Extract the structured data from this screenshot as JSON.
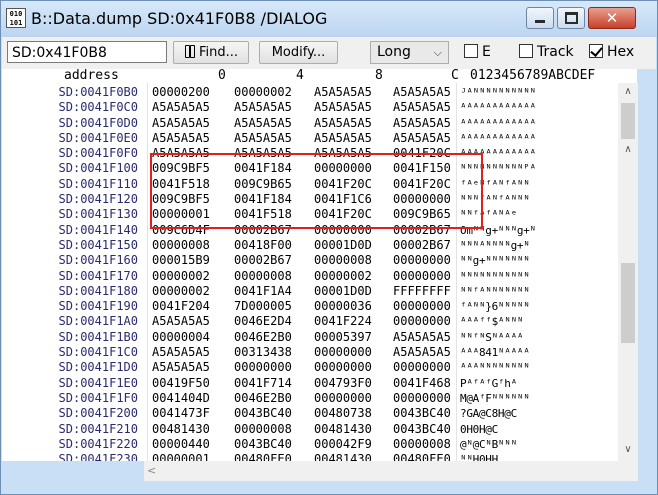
{
  "window": {
    "title": "B::Data.dump SD:0x41F0B8 /DIALOG",
    "icon_text": "010 101"
  },
  "toolbar": {
    "address_value": "SD:0x41F0B8",
    "find_label": "Find...",
    "modify_label": "Modify...",
    "format_selected": "Long",
    "checkbox_e_label": "E",
    "checkbox_e_checked": false,
    "checkbox_track_label": "Track",
    "checkbox_track_checked": false,
    "checkbox_hex_label": "Hex",
    "checkbox_hex_checked": true
  },
  "header": {
    "address": "address",
    "col0": "0",
    "col4": "4",
    "col8": "8",
    "colC": "C",
    "ascii": "0123456789ABCDEF"
  },
  "rows": [
    {
      "addr": "SD:0041F0B0",
      "c0": "00000200",
      "c1": "00000002",
      "c2": "A5A5A5A5",
      "c3": "A5A5A5A5",
      "ascii": "ᴶᴬᴺᴺᴺᴺᴺᴺᴺᴺᴺᴺ"
    },
    {
      "addr": "SD:0041F0C0",
      "c0": "A5A5A5A5",
      "c1": "A5A5A5A5",
      "c2": "A5A5A5A5",
      "c3": "A5A5A5A5",
      "ascii": "ᴬᴬᴬᴬᴬᴬᴬᴬᴬᴬᴬᴬ"
    },
    {
      "addr": "SD:0041F0D0",
      "c0": "A5A5A5A5",
      "c1": "A5A5A5A5",
      "c2": "A5A5A5A5",
      "c3": "A5A5A5A5",
      "ascii": "ᴬᴬᴬᴬᴬᴬᴬᴬᴬᴬᴬᴬ"
    },
    {
      "addr": "SD:0041F0E0",
      "c0": "A5A5A5A5",
      "c1": "A5A5A5A5",
      "c2": "A5A5A5A5",
      "c3": "A5A5A5A5",
      "ascii": "ᴬᴬᴬᴬᴬᴬᴬᴬᴬᴬᴬᴬ"
    },
    {
      "addr": "SD:0041F0F0",
      "c0": "A5A5A5A5",
      "c1": "A5A5A5A5",
      "c2": "A5A5A5A5",
      "c3": "0041F20C",
      "ascii": "ᴬᴬᴬᴬᴬᴬᴬᴬᴬᴬᴬᴬ"
    },
    {
      "addr": "SD:0041F100",
      "c0": "009C9BF5",
      "c1": "0041F184",
      "c2": "00000000",
      "c3": "0041F150",
      "ascii": "ᴺᴺᴺᴺᴺᴺᴺᴺᴺᴺᴾᴬ"
    },
    {
      "addr": "SD:0041F110",
      "c0": "0041F518",
      "c1": "009C9B65",
      "c2": "0041F20C",
      "c3": "0041F20C",
      "ascii": "ᶠᴬᵉᴺᶠᴬᴺᶠᴬᴺᴺ"
    },
    {
      "addr": "SD:0041F120",
      "c0": "009C9BF5",
      "c1": "0041F184",
      "c2": "0041F1C6",
      "c3": "00000000",
      "ascii": "ᴺᴺᴺᶠᴬᴺᶠᴬᴺᴺᴺ"
    },
    {
      "addr": "SD:0041F130",
      "c0": "00000001",
      "c1": "0041F518",
      "c2": "0041F20C",
      "c3": "009C9B65",
      "ascii": "ᴺᴺᶠᴬᶠᴬᴺᴬᵉ"
    },
    {
      "addr": "SD:0041F140",
      "c0": "009C6D4F",
      "c1": "00002B67",
      "c2": "00000000",
      "c3": "00002B67",
      "ascii": "Omᴺᴺg+ᴺᴺᴺg+ᴺ"
    },
    {
      "addr": "SD:0041F150",
      "c0": "00000008",
      "c1": "00418F00",
      "c2": "00001D0D",
      "c3": "00002B67",
      "ascii": "ᴺᴺᴺᴬᴺᴺᴺᴺg+ᴺ"
    },
    {
      "addr": "SD:0041F160",
      "c0": "000015B9",
      "c1": "00002B67",
      "c2": "00000008",
      "c3": "00000000",
      "ascii": "ᴺᴺg+ᴺᴺᴺᴺᴺᴺᴺ"
    },
    {
      "addr": "SD:0041F170",
      "c0": "00000002",
      "c1": "00000008",
      "c2": "00000002",
      "c3": "00000000",
      "ascii": "ᴺᴺᴺᴺᴺᴺᴺᴺᴺᴺᴺ"
    },
    {
      "addr": "SD:0041F180",
      "c0": "00000002",
      "c1": "0041F1A4",
      "c2": "00001D0D",
      "c3": "FFFFFFFF",
      "ascii": "ᴺᴺᶠᴬᴺᴺᴺᴺᴺᴺᴺ"
    },
    {
      "addr": "SD:0041F190",
      "c0": "0041F204",
      "c1": "7D000005",
      "c2": "00000036",
      "c3": "00000000",
      "ascii": "ᶠᴬᴺᴺ}6ᴺᴺᴺᴺᴺ"
    },
    {
      "addr": "SD:0041F1A0",
      "c0": "A5A5A5A5",
      "c1": "0046E2D4",
      "c2": "0041F224",
      "c3": "00000000",
      "ascii": "ᴬᴬᴬᶠᶠ$ᴬᴺᴺᴺ"
    },
    {
      "addr": "SD:0041F1B0",
      "c0": "00000004",
      "c1": "0046E2B0",
      "c2": "00005397",
      "c3": "A5A5A5A5",
      "ascii": "ᴺᴺᶠᴺSᴺᴬᴬᴬᴬ"
    },
    {
      "addr": "SD:0041F1C0",
      "c0": "A5A5A5A5",
      "c1": "00313438",
      "c2": "00000000",
      "c3": "A5A5A5A5",
      "ascii": "ᴬᴬᴬ841ᴺᴬᴬᴬᴬ"
    },
    {
      "addr": "SD:0041F1D0",
      "c0": "A5A5A5A5",
      "c1": "00000000",
      "c2": "00000000",
      "c3": "00000000",
      "ascii": "ᴬᴬᴬᴺᴺᴺᴺᴺᴺᴺᴺ"
    },
    {
      "addr": "SD:0041F1E0",
      "c0": "00419F50",
      "c1": "0041F714",
      "c2": "004793F0",
      "c3": "0041F468",
      "ascii": "PᴬᶠᴬᶠGᶠhᴬ"
    },
    {
      "addr": "SD:0041F1F0",
      "c0": "0041404D",
      "c1": "0046E2B0",
      "c2": "00000000",
      "c3": "00000000",
      "ascii": "M@AᶠFᴺᴺᴺᴺᴺᴺ"
    },
    {
      "addr": "SD:0041F200",
      "c0": "0041473F",
      "c1": "0043BC40",
      "c2": "00480738",
      "c3": "0043BC40",
      "ascii": "?GA@C8H@C"
    },
    {
      "addr": "SD:0041F210",
      "c0": "00481430",
      "c1": "00000008",
      "c2": "00481430",
      "c3": "0043BC40",
      "ascii": "0H0H@C"
    },
    {
      "addr": "SD:0041F220",
      "c0": "00000440",
      "c1": "0043BC40",
      "c2": "000042F9",
      "c3": "00000008",
      "ascii": "@ᴺ@CᴺBᴺᴺᴺ"
    },
    {
      "addr": "SD:0041F230",
      "c0": "00000001",
      "c1": "00480FE0",
      "c2": "00481430",
      "c3": "00480FE0",
      "ascii": "ᴺᴺH0HH"
    }
  ]
}
